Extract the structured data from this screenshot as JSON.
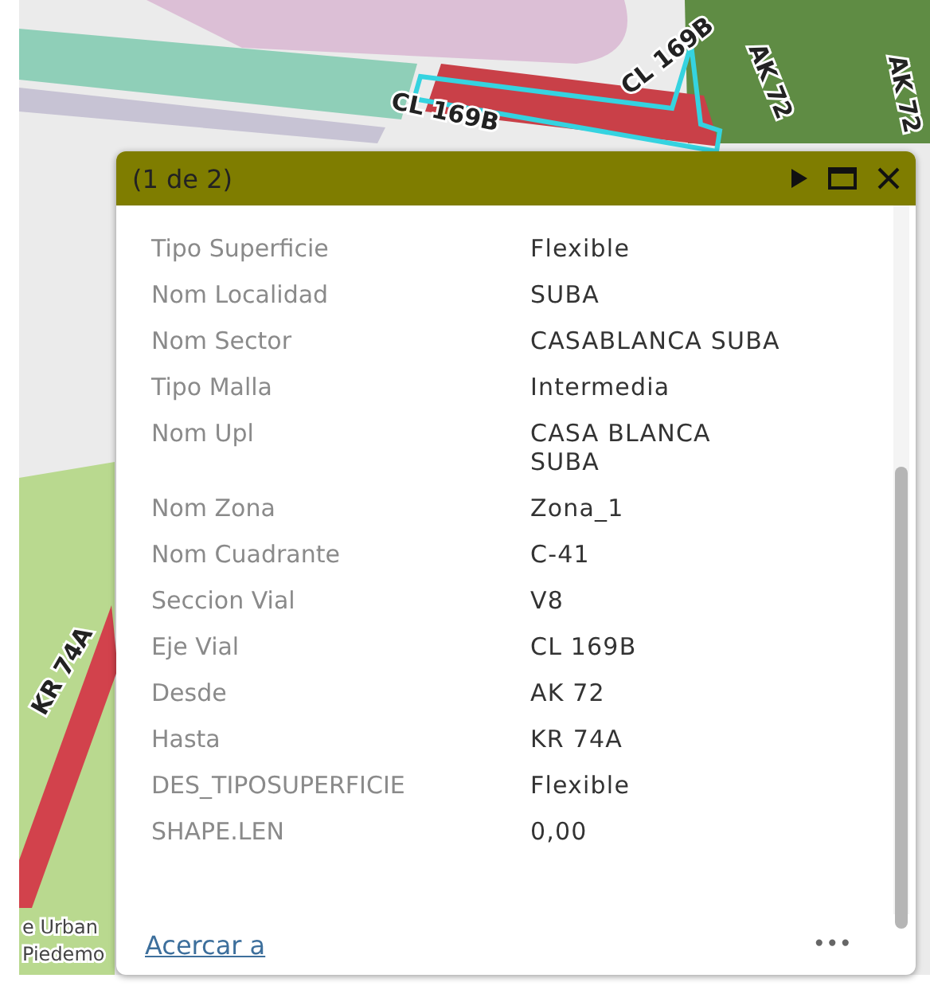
{
  "map": {
    "labels": [
      {
        "text": "CL 169B"
      },
      {
        "text": "CL 169B"
      },
      {
        "text": "AK 72"
      },
      {
        "text": "AK 72"
      },
      {
        "text": "KR 74A"
      },
      {
        "text": "e Urban"
      },
      {
        "text": "Piedemo"
      }
    ]
  },
  "popup": {
    "title": "(1 de 2)",
    "fields": [
      {
        "label": "Tipo Superficie",
        "value": "Flexible"
      },
      {
        "label": "Nom Localidad",
        "value": "SUBA"
      },
      {
        "label": "Nom Sector",
        "value": "CASABLANCA SUBA"
      },
      {
        "label": "Tipo Malla",
        "value": "Intermedia"
      },
      {
        "label": "Nom Upl",
        "value": "CASA BLANCA SUBA"
      },
      {
        "label": "Nom Zona",
        "value": "Zona_1"
      },
      {
        "label": "Nom Cuadrante",
        "value": "C-41"
      },
      {
        "label": "Seccion Vial",
        "value": "V8"
      },
      {
        "label": "Eje Vial",
        "value": "CL 169B"
      },
      {
        "label": "Desde",
        "value": "AK 72"
      },
      {
        "label": "Hasta",
        "value": "KR 74A"
      },
      {
        "label": "DES_TIPOSUPERFICIE",
        "value": "Flexible"
      },
      {
        "label": "SHAPE.LEN",
        "value": "0,00"
      }
    ],
    "zoom_link": "Acercar a",
    "more": "•••"
  }
}
